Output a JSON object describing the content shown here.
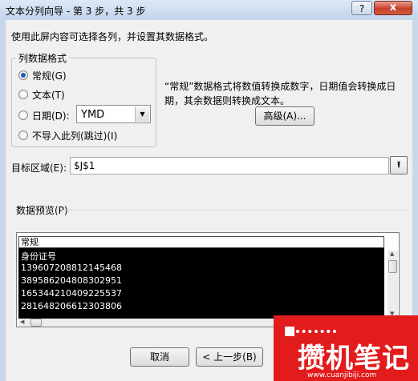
{
  "window": {
    "title": "文本分列向导 - 第 3 步，共 3 步",
    "help": "?",
    "close": "x"
  },
  "instruction": "使用此屏内容可选择各列，并设置其数据格式。",
  "format_group": {
    "title": "列数据格式",
    "options": [
      {
        "label": "常规(G)",
        "checked": true
      },
      {
        "label": "文本(T)",
        "checked": false
      },
      {
        "label": "日期(D):",
        "checked": false
      },
      {
        "label": "不导入此列(跳过)(I)",
        "checked": false
      }
    ],
    "date_format": "YMD"
  },
  "description": "“常规”数据格式将数值转换成数字，日期值会转换成日期，其余数据则转换成文本。",
  "advanced_button": "高级(A)...",
  "target": {
    "label": "目标区域(E):",
    "value": "$J$1"
  },
  "preview": {
    "title": "数据预览(P)",
    "column_header": "常规",
    "rows": [
      "身份证号",
      "139607208812145468",
      "389586204808302951",
      "165344210409225537",
      "281648206612303806"
    ]
  },
  "buttons": {
    "cancel": "取消",
    "back": "< 上一步(B)"
  },
  "watermark": {
    "text": "攒机笔记",
    "url": "www.cuanjibiji.com"
  }
}
